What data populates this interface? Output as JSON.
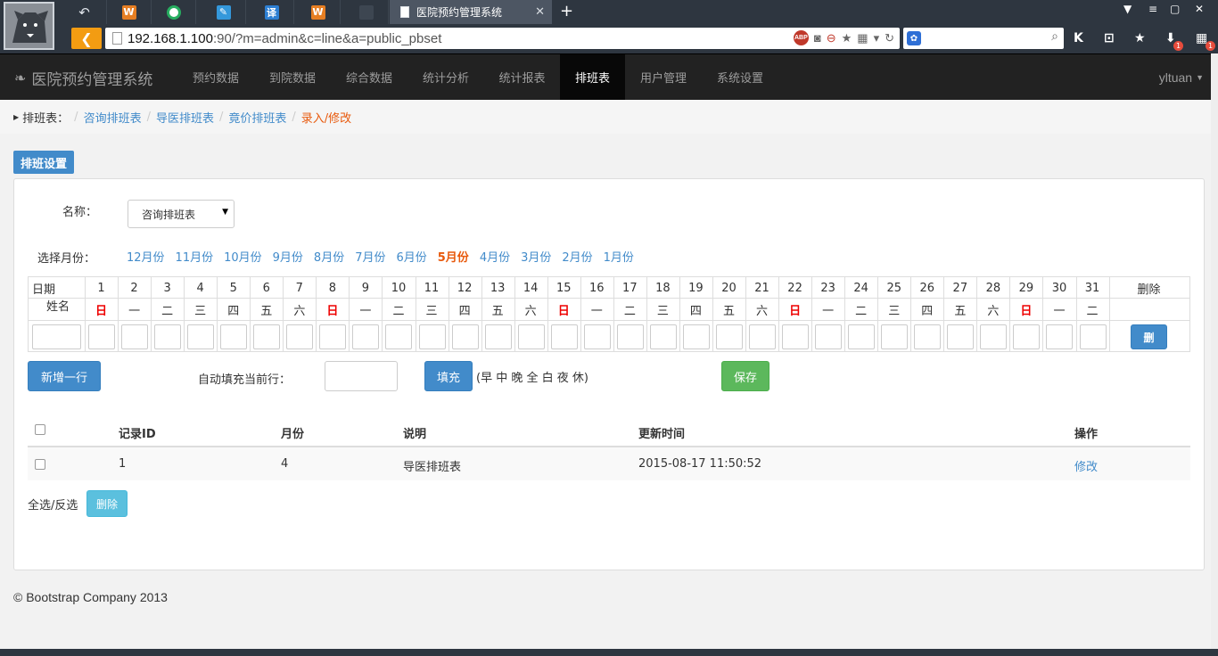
{
  "browser": {
    "active_tab_title": "医院预约管理系统",
    "url_host": "192.168.1.100",
    "url_rest": ":90/?m=admin&c=line&a=public_pbset",
    "tab_fav_letters": [
      "W",
      "",
      "",
      "译",
      "W",
      ""
    ],
    "badge_count": "1"
  },
  "navbar": {
    "brand": "医院预约管理系统",
    "items": [
      {
        "label": "预约数据"
      },
      {
        "label": "到院数据"
      },
      {
        "label": "综合数据"
      },
      {
        "label": "统计分析"
      },
      {
        "label": "统计报表"
      },
      {
        "label": "排班表"
      },
      {
        "label": "用户管理"
      },
      {
        "label": "系统设置"
      }
    ],
    "active": "排班表",
    "user": "yltuan"
  },
  "breadcrumb": {
    "root": "排班表：",
    "links": [
      "咨询排班表",
      "导医排班表",
      "竟价排班表"
    ],
    "current": "录入/修改"
  },
  "section_title": "排班设置",
  "form": {
    "name_label": "名称：",
    "name_value": "咨询排班表",
    "month_label": "选择月份：",
    "months": [
      "12月份",
      "11月份",
      "10月份",
      "9月份",
      "8月份",
      "7月份",
      "6月份",
      "5月份",
      "4月份",
      "3月份",
      "2月份",
      "1月份"
    ],
    "selected_month": "5月份"
  },
  "grid": {
    "corner_top": "日期",
    "corner_bottom": "姓名",
    "days": [
      "1",
      "2",
      "3",
      "4",
      "5",
      "6",
      "7",
      "8",
      "9",
      "10",
      "11",
      "12",
      "13",
      "14",
      "15",
      "16",
      "17",
      "18",
      "19",
      "20",
      "21",
      "22",
      "23",
      "24",
      "25",
      "26",
      "27",
      "28",
      "29",
      "30",
      "31"
    ],
    "weekdays": [
      "日",
      "一",
      "二",
      "三",
      "四",
      "五",
      "六",
      "日",
      "一",
      "二",
      "三",
      "四",
      "五",
      "六",
      "日",
      "一",
      "二",
      "三",
      "四",
      "五",
      "六",
      "日",
      "一",
      "二",
      "三",
      "四",
      "五",
      "六",
      "日",
      "一",
      "二"
    ],
    "delete_header": "删除",
    "delete_button": "删"
  },
  "actions": {
    "add_row": "新增一行",
    "autofill_label": "自动填充当前行：",
    "fill_button": "填充",
    "fill_hint": "(早 中 晚 全 白 夜 休)",
    "save": "保存"
  },
  "records": {
    "headers": {
      "id": "记录ID",
      "month": "月份",
      "desc": "说明",
      "updated": "更新时间",
      "op": "操作"
    },
    "rows": [
      {
        "id": "1",
        "month": "4",
        "desc": "导医排班表",
        "updated": "2015-08-17 11:50:52",
        "op": "修改"
      }
    ],
    "select_all": "全选/反选",
    "delete": "删除"
  },
  "footer": "© Bootstrap Company 2013",
  "colors": {
    "primary": "#428bca",
    "success": "#5cb85c",
    "info": "#5bc0de",
    "navbar": "#222222",
    "selected_month": "#e8590c",
    "sunday": "#ee0000"
  }
}
